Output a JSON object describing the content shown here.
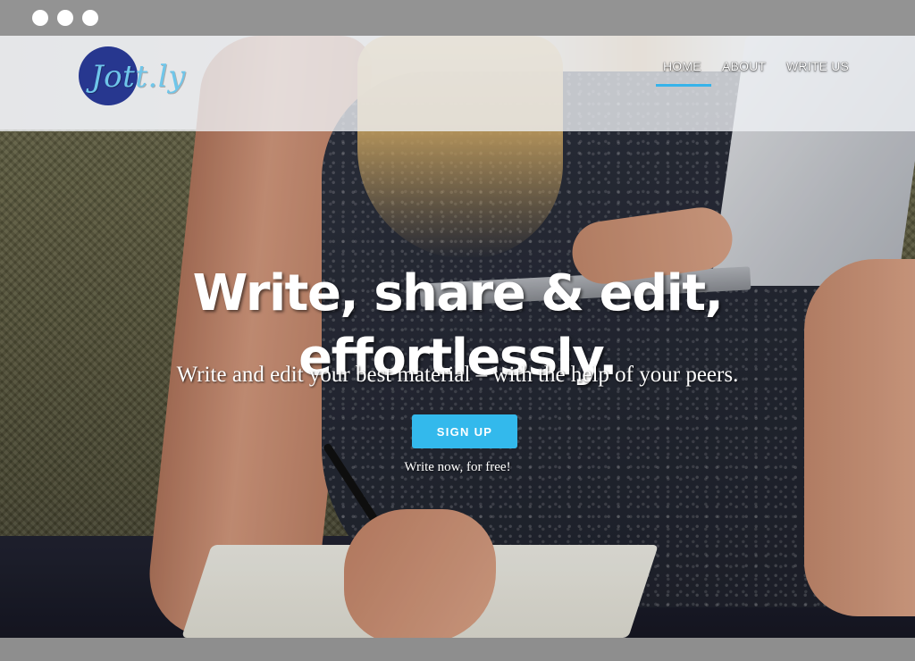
{
  "window": {
    "controls": [
      "dot",
      "dot",
      "dot"
    ]
  },
  "brand": {
    "logo_text": "Jott.ly",
    "logo_color": "#27378f",
    "logo_text_color": "#6fc6ea"
  },
  "nav": {
    "items": [
      {
        "label": "HOME",
        "active": true
      },
      {
        "label": "ABOUT",
        "active": false
      },
      {
        "label": "WRITE US",
        "active": false
      }
    ],
    "active_indicator_color": "#36b3ea"
  },
  "hero": {
    "title_line1": "Write, share & edit,",
    "title_line2": "effortlessly.",
    "subtitle": "Write and edit your best material – with the help of your peers.",
    "cta_label": "SIGN UP",
    "cta_color": "#33b9ec",
    "note": "Write now, for free!"
  }
}
